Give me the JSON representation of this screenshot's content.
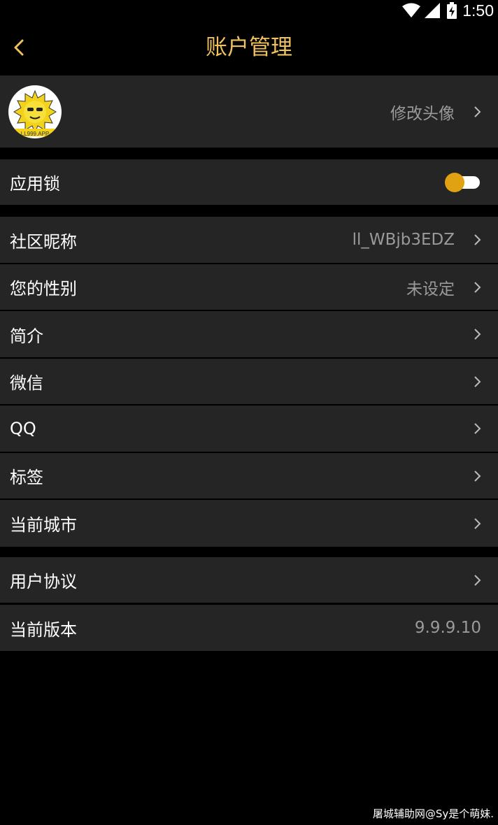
{
  "status_bar": {
    "time": "1:50",
    "icons": [
      "wifi-icon",
      "cell-signal-icon",
      "battery-charging-icon"
    ]
  },
  "header": {
    "title": "账户管理",
    "back_icon": "chevron-left-icon",
    "accent_color": "#f0c25e"
  },
  "avatar_row": {
    "action_label": "修改头像",
    "avatar_badge_text": "LL999.APP"
  },
  "app_lock": {
    "label": "应用锁",
    "enabled": true,
    "toggle_color": "#e0a213"
  },
  "profile_rows": [
    {
      "label": "社区昵称",
      "value": "ll_WBjb3EDZ"
    },
    {
      "label": "您的性别",
      "value": "未设定"
    },
    {
      "label": "简介",
      "value": ""
    },
    {
      "label": "微信",
      "value": ""
    },
    {
      "label": "QQ",
      "value": ""
    },
    {
      "label": "标签",
      "value": ""
    },
    {
      "label": "当前城市",
      "value": ""
    }
  ],
  "about_rows": [
    {
      "label": "用户协议",
      "value": ""
    },
    {
      "label": "当前版本",
      "value": "9.9.9.10"
    }
  ],
  "watermark": "屠城辅助网@Sy是个萌妹."
}
